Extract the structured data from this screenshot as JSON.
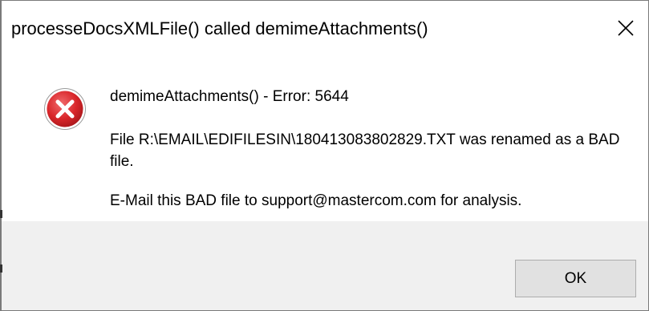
{
  "window": {
    "title": "processeDocsXMLFile() called demimeAttachments()",
    "close_icon": "close-icon"
  },
  "message": {
    "icon": "error-icon",
    "heading": "demimeAttachments() - Error: 5644",
    "renamed": "File R:\\EMAIL\\EDIFILESIN\\180413083802829.TXT was renamed as a BAD file.",
    "email": "E-Mail this BAD file to support@mastercom.com for analysis."
  },
  "buttons": {
    "ok_label": "OK"
  },
  "colors": {
    "icon_red": "#e0383b",
    "footer_bg": "#f0f0f0",
    "button_bg": "#e1e1e1"
  }
}
